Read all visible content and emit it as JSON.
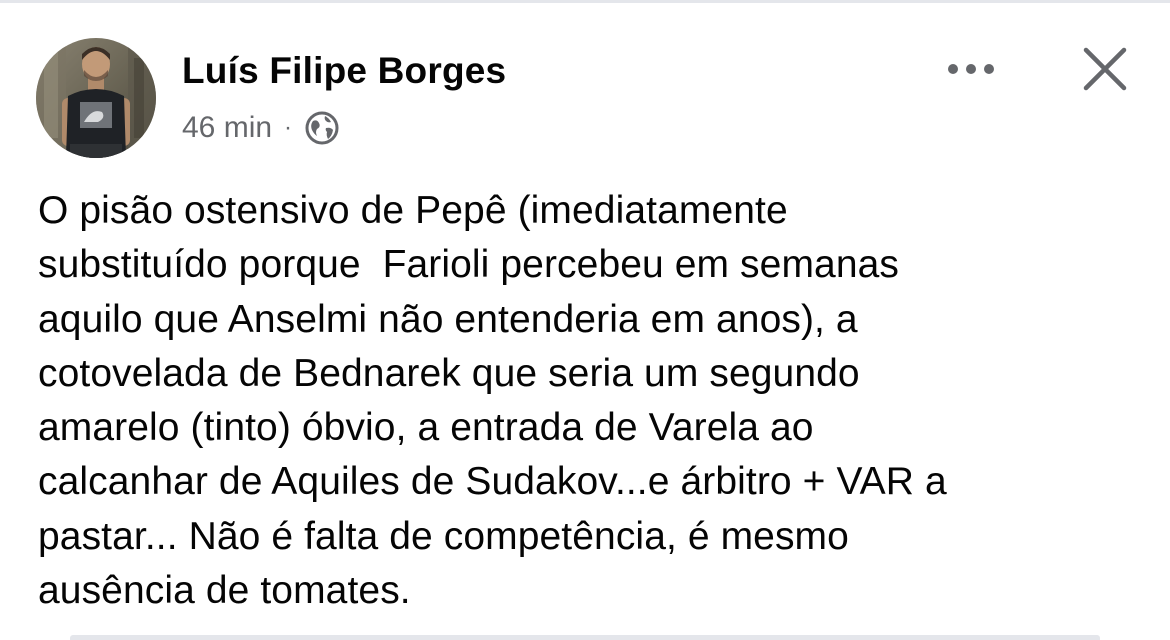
{
  "post": {
    "author": "Luís Filipe Borges",
    "timestamp": "46 min",
    "separator": "·",
    "audience_icon": "globe-icon",
    "more_icon": "more-options-icon",
    "close_icon": "close-icon",
    "body_lines": [
      "O pisão ostensivo de Pepê (imediatamente",
      "substituído porque  Farioli percebeu em semanas",
      "aquilo que Anselmi não entenderia em anos), a",
      "cotovelada de Bednarek que seria um segundo",
      "amarelo (tinto) óbvio, a entrada de Varela ao",
      "calcanhar de Aquiles de Sudakov...e árbitro + VAR a",
      "pastar... Não é falta de competência, é mesmo",
      "ausência de tomates."
    ]
  },
  "colors": {
    "text_primary": "#050505",
    "text_secondary": "#65676b",
    "divider": "#e4e6eb",
    "background": "#ffffff"
  }
}
